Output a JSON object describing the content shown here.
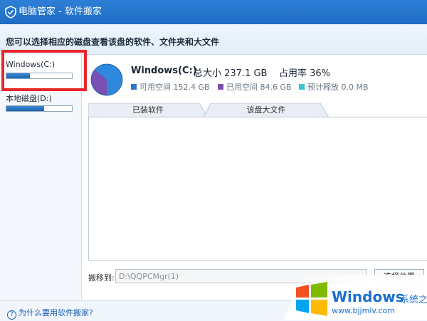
{
  "window": {
    "title": "电脑管家 - 软件搬家"
  },
  "header": {
    "description": "您可以选择相应的磁盘查看该盘的软件、文件夹和大文件"
  },
  "sidebar": {
    "drives": [
      {
        "name": "Windows(C:)",
        "used_fraction": 0.36,
        "selected": true
      },
      {
        "name": "本地磁盘(D:)",
        "used_fraction": 0.58,
        "selected": false
      }
    ]
  },
  "disk": {
    "name": "Windows(C:)",
    "total": "总大小 237.1 GB",
    "usage_rate": "占用率 36%",
    "legend": [
      {
        "label": "可用空间 152.4 GB",
        "color": "#2f77c8"
      },
      {
        "label": "已用空间 84.6 GB",
        "color": "#7b4fb3"
      },
      {
        "label": "预计释放 0.0 MB",
        "color": "#36c3d4"
      }
    ],
    "pie_colors": {
      "free": "#2f88dc",
      "used": "#7b4fb3"
    }
  },
  "tabs": [
    {
      "label": "已装软件"
    },
    {
      "label": "该盘大文件"
    }
  ],
  "move": {
    "label": "搬移到:",
    "path": "D:\\QQPCMgr(1)",
    "button": "选择位置"
  },
  "footer": {
    "help_link": "为什么要用软件搬家?"
  },
  "watermark": {
    "brand": "Windows",
    "site_name": "系统之家",
    "url": "www.bjjmlv.com"
  }
}
